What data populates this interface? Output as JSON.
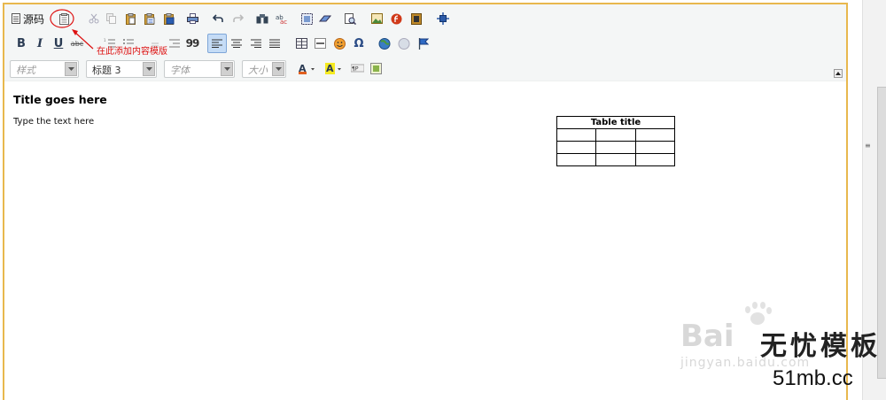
{
  "toolbar": {
    "source_label": "源码",
    "style_combo": "样式",
    "format_combo": "标题 3",
    "font_combo": "字体",
    "size_combo": "大小",
    "bold_label": "B",
    "italic_label": "I",
    "underline_label": "U",
    "strike_label": "abc",
    "quote_label": "99",
    "special_char_label": "Ω"
  },
  "annotation": {
    "text": "在此添加内容模版"
  },
  "content": {
    "title": "Title goes here",
    "text": "Type the text here",
    "table_title": "Table title"
  },
  "watermark": {
    "baidu": "Bai",
    "jingyan": "jingyan.baidu.com",
    "site_cn": "无忧模板",
    "domain": "51mb.cc"
  },
  "colors": {
    "editor_border": "#e8b84d",
    "annotation": "#dd1111",
    "toolbar_bg": "#f4f6f6"
  }
}
